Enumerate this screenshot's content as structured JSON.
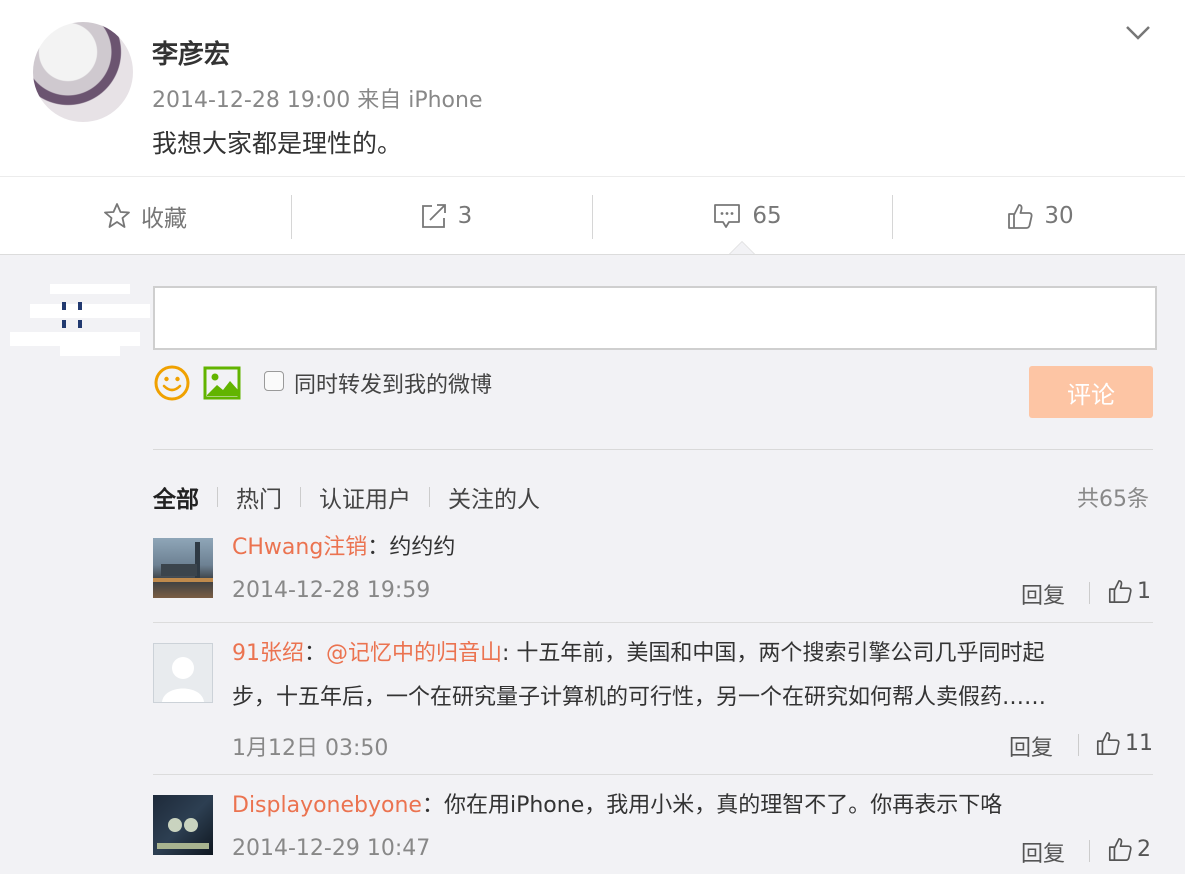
{
  "post": {
    "author": "李彦宏",
    "meta": "2014-12-28 19:00 来自 iPhone",
    "text": "我想大家都是理性的。"
  },
  "actions": {
    "favorite_label": "收藏",
    "repost_count": "3",
    "comment_count": "65",
    "like_count": "30"
  },
  "comment_box": {
    "repost_option_label": "同时转发到我的微博",
    "submit_label": "评论"
  },
  "filters": {
    "items": [
      "全部",
      "热门",
      "认证用户",
      "关注的人"
    ],
    "active": "全部",
    "total": "共65条"
  },
  "comments": [
    {
      "user": "CHwang注销",
      "separator": "：",
      "text": "约约约",
      "time": "2014-12-28 19:59",
      "reply_label": "回复",
      "likes": "1"
    },
    {
      "user": "91张绍",
      "separator": "：",
      "mention": "@记忆中的归音山",
      "text_line1": ": 十五年前，美国和中国，两个搜索引擎公司几乎同时起",
      "text_line2": "步，十五年后，一个在研究量子计算机的可行性，另一个在研究如何帮人卖假药……",
      "time": "1月12日 03:50",
      "reply_label": "回复",
      "likes": "11"
    },
    {
      "user": "Displayonebyone",
      "separator": "：",
      "text": "你在用iPhone，我用小米，真的理智不了。你再表示下咯",
      "time": "2014-12-29 10:47",
      "reply_label": "回复",
      "likes": "2"
    }
  ]
}
